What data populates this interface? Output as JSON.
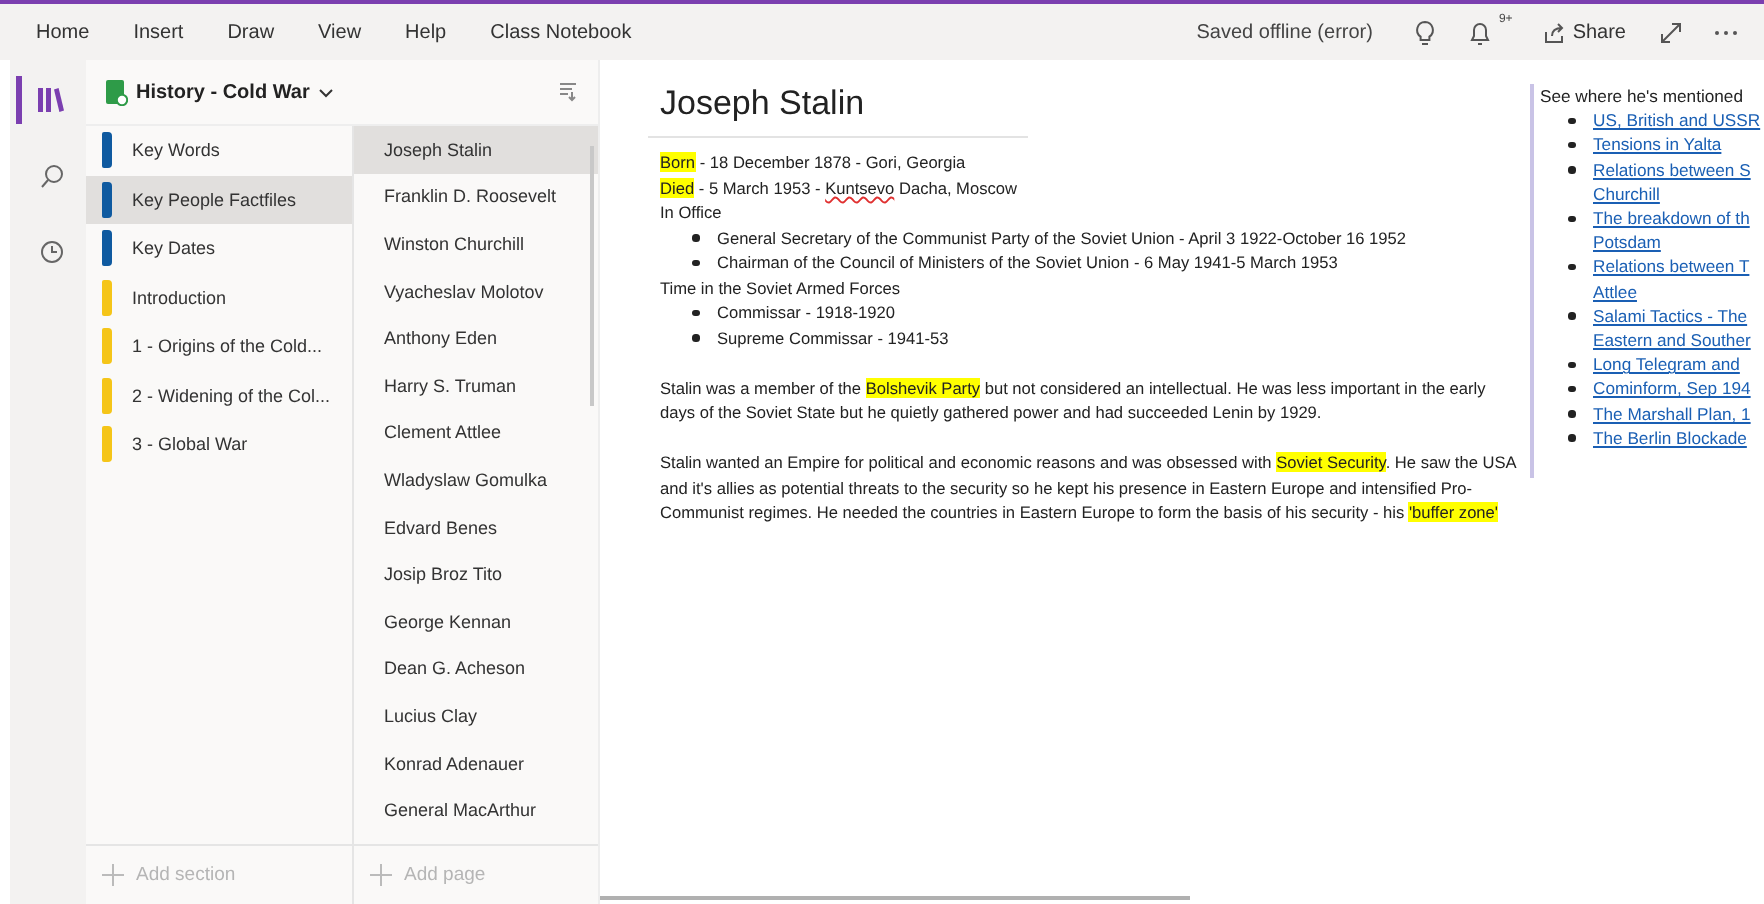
{
  "menu": [
    {
      "label": "Home"
    },
    {
      "label": "Insert"
    },
    {
      "label": "Draw"
    },
    {
      "label": "View"
    },
    {
      "label": "Help"
    },
    {
      "label": "Class Notebook"
    }
  ],
  "status": "Saved offline (error)",
  "notification_badge": "9+",
  "share": "Share",
  "notebook": {
    "title": "History - Cold War"
  },
  "sections": [
    {
      "label": "Key Words",
      "color": "#0f5aa0",
      "selected": false
    },
    {
      "label": "Key People Factfiles",
      "color": "#0f5aa0",
      "selected": true
    },
    {
      "label": "Key Dates",
      "color": "#0f5aa0",
      "selected": false
    },
    {
      "label": "Introduction",
      "color": "#f5c518",
      "selected": false
    },
    {
      "label": "1 - Origins of the Cold...",
      "color": "#f5c518",
      "selected": false
    },
    {
      "label": "2 - Widening of the Col...",
      "color": "#f5c518",
      "selected": false
    },
    {
      "label": "3 - Global War",
      "color": "#f5c518",
      "selected": false
    }
  ],
  "pages": [
    {
      "label": "Joseph Stalin",
      "selected": true
    },
    {
      "label": "Franklin D. Roosevelt",
      "selected": false
    },
    {
      "label": "Winston Churchill",
      "selected": false
    },
    {
      "label": "Vyacheslav Molotov",
      "selected": false
    },
    {
      "label": "Anthony Eden",
      "selected": false
    },
    {
      "label": "Harry S. Truman",
      "selected": false
    },
    {
      "label": "Clement Attlee",
      "selected": false
    },
    {
      "label": "Wladyslaw Gomulka",
      "selected": false
    },
    {
      "label": "Edvard Benes",
      "selected": false
    },
    {
      "label": "Josip Broz Tito",
      "selected": false
    },
    {
      "label": "George Kennan",
      "selected": false
    },
    {
      "label": "Dean G. Acheson",
      "selected": false
    },
    {
      "label": "Lucius Clay",
      "selected": false
    },
    {
      "label": "Konrad Adenauer",
      "selected": false
    },
    {
      "label": "General MacArthur",
      "selected": false
    }
  ],
  "add_section": "Add section",
  "add_page": "Add page",
  "page": {
    "title": "Joseph Stalin",
    "blocks": [
      {
        "kind": "line",
        "segments": [
          {
            "text": "Born",
            "highlight": true
          },
          {
            "text": " - 18 December 1878 - Gori, Georgia"
          }
        ]
      },
      {
        "kind": "line",
        "segments": [
          {
            "text": "Died",
            "highlight": true
          },
          {
            "text": " - 5 March 1953 - "
          },
          {
            "text": "Kuntsevo",
            "misspelled": true
          },
          {
            "text": " Dacha, Moscow"
          }
        ]
      },
      {
        "kind": "line",
        "segments": [
          {
            "text": "In Office"
          }
        ]
      },
      {
        "kind": "bullet",
        "segments": [
          {
            "text": "General Secretary of the Communist Party of the Soviet Union - April 3 1922-October 16 1952"
          }
        ]
      },
      {
        "kind": "bullet",
        "segments": [
          {
            "text": "Chairman of the Council of Ministers of the Soviet Union - 6 May 1941-5 March 1953"
          }
        ]
      },
      {
        "kind": "line",
        "segments": [
          {
            "text": "Time in the Soviet Armed Forces"
          }
        ]
      },
      {
        "kind": "bullet",
        "segments": [
          {
            "text": "Commissar - 1918-1920"
          }
        ]
      },
      {
        "kind": "bullet",
        "segments": [
          {
            "text": "Supreme Commissar - 1941-53"
          }
        ]
      },
      {
        "kind": "para",
        "segments": [
          {
            "text": "Stalin was a member of the "
          },
          {
            "text": "Bolshevik Party",
            "highlight": true
          },
          {
            "text": " but not considered an intellectual. He was less important in the early days of the Soviet State but he quietly gathered power and had succeeded Lenin by 1929."
          }
        ]
      },
      {
        "kind": "para",
        "segments": [
          {
            "text": "Stalin wanted an Empire for political and economic reasons and was obsessed with "
          },
          {
            "text": "Soviet Security",
            "highlight": true
          },
          {
            "text": ". He saw the USA and it's allies as potential threats to the security so he kept his presence in Eastern Europe and intensified Pro-Communist regimes. He needed the countries in Eastern Europe to form the basis of his security - his "
          },
          {
            "text": "'buffer zone'",
            "highlight": true
          }
        ]
      }
    ]
  },
  "mentions": {
    "heading": "See where he's mentioned",
    "links": [
      {
        "lines": [
          "US, British and USSR"
        ]
      },
      {
        "lines": [
          "Tensions in Yalta"
        ]
      },
      {
        "lines": [
          "Relations between S",
          "Churchill"
        ]
      },
      {
        "lines": [
          "The breakdown of th",
          "Potsdam"
        ]
      },
      {
        "lines": [
          "Relations between T",
          "Attlee"
        ]
      },
      {
        "lines": [
          "Salami Tactics - The",
          "Eastern and Souther"
        ]
      },
      {
        "lines": [
          "Long Telegram and"
        ]
      },
      {
        "lines": [
          "Cominform, Sep 194"
        ]
      },
      {
        "lines": [
          "The Marshall Plan, 1"
        ]
      },
      {
        "lines": [
          "The Berlin Blockade"
        ]
      }
    ]
  }
}
